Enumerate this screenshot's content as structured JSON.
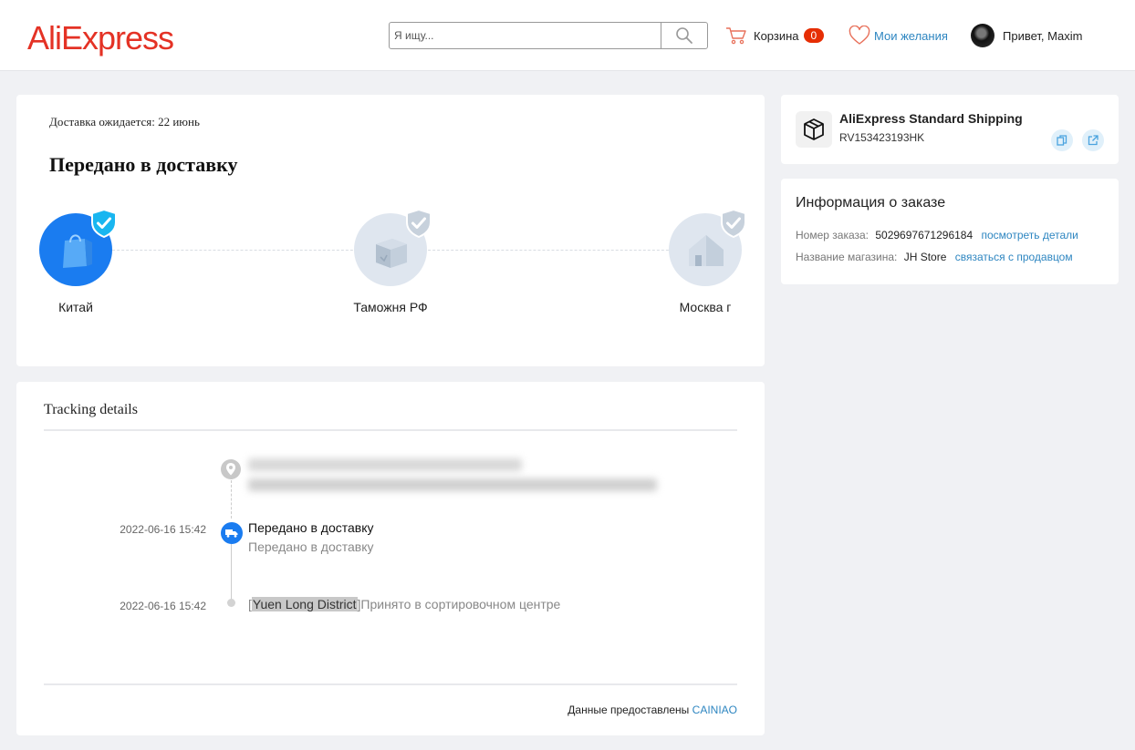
{
  "header": {
    "logo": "AliExpress",
    "search_placeholder": "Я ищу...",
    "cart_label": "Корзина",
    "cart_count": "0",
    "wishlist_label": "Мои желания",
    "user_greeting": "Привет, Maxim"
  },
  "status": {
    "eta": "Доставка ожидается: 22 июнь",
    "title": "Передано в доставку",
    "steps": [
      {
        "label": "Китай",
        "done": true,
        "icon": "shopping-bag-icon"
      },
      {
        "label": "Таможня РФ",
        "done": false,
        "icon": "package-icon"
      },
      {
        "label": "Москва г",
        "done": false,
        "icon": "house-icon"
      }
    ]
  },
  "tracking": {
    "title": "Tracking details",
    "events": [
      {
        "time": "2022-06-16 15:42",
        "title": "Передано в доставку",
        "subtitle": "Передано в доставку"
      },
      {
        "time": "2022-06-16 15:42",
        "prefix": "[",
        "location": "Yuen Long District",
        "suffix": "]",
        "text": "Принято в сортировочном центре"
      }
    ],
    "source_prefix": "Данные предоставлены",
    "source_link": "CAINIAO"
  },
  "shipping": {
    "carrier": "AliExpress Standard Shipping",
    "tracking_number": "RV153423193HK"
  },
  "order_info": {
    "title": "Информация о заказе",
    "order_label": "Номер заказа:",
    "order_number": "5029697671296184",
    "order_link": "посмотреть детали",
    "store_label": "Название магазина:",
    "store_name": "JH Store",
    "store_link": "связаться с продавцом"
  },
  "colors": {
    "brand": "#e43225",
    "accent": "#1a7cf0",
    "link": "#2e86c1",
    "badge": "#e62e04"
  }
}
